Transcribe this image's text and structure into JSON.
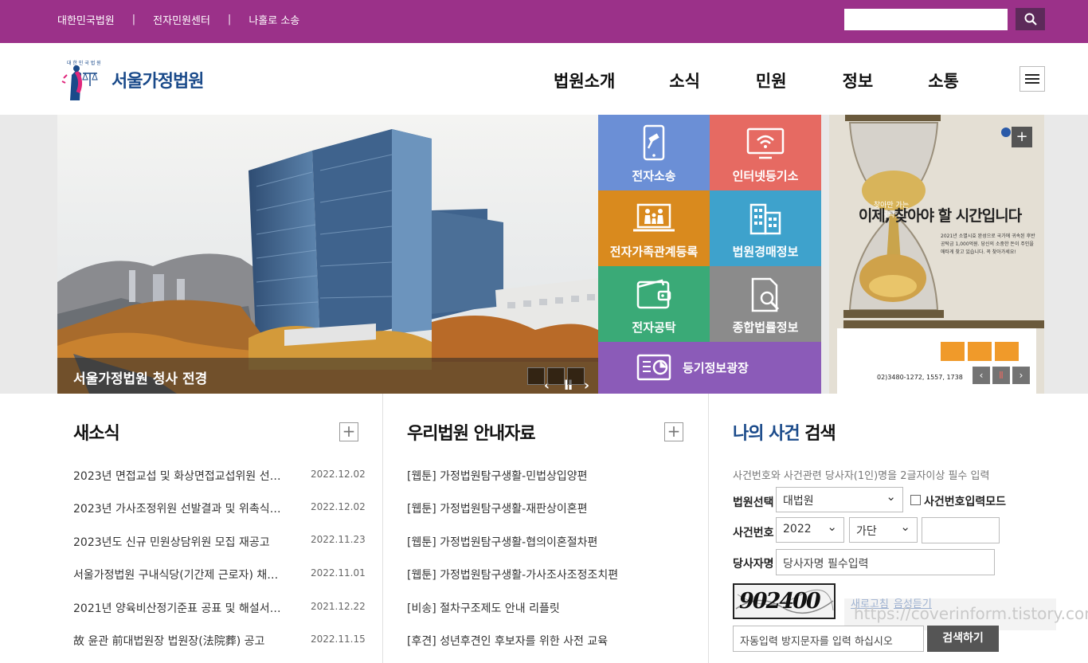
{
  "topbar": {
    "links": [
      "대한민국법원",
      "전자민원센터",
      "나홀로 소송"
    ],
    "separator": "|",
    "search_placeholder": "",
    "search_icon": "search-icon"
  },
  "header": {
    "logo_small_text": "대 한 민 국 법 원",
    "logo_text": "서울가정법원",
    "menu": [
      "법원소개",
      "소식",
      "민원",
      "정보",
      "소통"
    ],
    "menu_icon": "hamburger-icon"
  },
  "visual": {
    "caption": "서울가정법원 청사 전경",
    "prev": "‹",
    "pause": "Ⅱ",
    "next": "›"
  },
  "tiles": [
    {
      "label": "전자소송",
      "icon": "tablet-gavel-icon",
      "color": "#6b8fd6"
    },
    {
      "label": "인터넷등기소",
      "icon": "monitor-wifi-icon",
      "color": "#e66a62"
    },
    {
      "label": "전자가족관계등록",
      "icon": "family-laptop-icon",
      "color": "#d98a1e"
    },
    {
      "label": "법원경매정보",
      "icon": "buildings-icon",
      "color": "#3ea2cc"
    },
    {
      "label": "전자공탁",
      "icon": "wallet-icon",
      "color": "#3aaa77"
    },
    {
      "label": "종합법률정보",
      "icon": "document-search-icon",
      "color": "#8b8b8b"
    },
    {
      "label": "등기정보광장",
      "icon": "chart-board-icon",
      "color": "#8b5bb8"
    }
  ],
  "poster": {
    "top_badge": "찾아만 가는 공탁금",
    "headline": "이제, 찾아야 할 시간입니다",
    "body": "2021년 소멸시효 완성으로 국가에 귀속된 후반 공탁금 1,000억원. 당신의 소중한 돈이 주인을 애타게 찾고 있습니다. 꼭 찾아가세요!",
    "phone": "02)3480-1272, 1557, 1738",
    "plus": "+"
  },
  "news": {
    "title": "새소식",
    "plus": "+",
    "items": [
      {
        "title": "2023년 면접교섭 및 화상면접교섭위원 선…",
        "date": "2022.12.02"
      },
      {
        "title": "2023년 가사조정위원 선발결과 및 위촉식…",
        "date": "2022.12.02"
      },
      {
        "title": "2023년도 신규 민원상담위원 모집 재공고",
        "date": "2022.11.23"
      },
      {
        "title": "서울가정법원 구내식당(기간제 근로자) 채…",
        "date": "2022.11.01"
      },
      {
        "title": "2021년 양육비산정기준표 공표 및 해설서…",
        "date": "2021.12.22"
      },
      {
        "title": "故 윤관 前대법원장 법원장(法院葬) 공고",
        "date": "2022.11.15"
      }
    ]
  },
  "guide": {
    "title": "우리법원 안내자료",
    "plus": "+",
    "items": [
      "[웹툰] 가정법원탐구생활-민법상입양편",
      "[웹툰] 가정법원탐구생활-재판상이혼편",
      "[웹툰] 가정법원탐구생활-협의이혼절차편",
      "[웹툰] 가정법원탐구생활-가사조사조정조치편",
      "[비송] 절차구조제도 안내 리플릿",
      "[후견] 성년후견인 후보자를 위한 사전 교육"
    ]
  },
  "case_search": {
    "title_highlight": "나의 사건",
    "title_rest": " 검색",
    "notice": "사건번호와 사건관련 당사자(1인)명을 2글자이상 필수 입력",
    "court_label": "법원선택",
    "court_value": "대법원",
    "mode_label": "사건번호입력모드",
    "case_label": "사건번호",
    "year_value": "2022",
    "type_value": "가단",
    "case_number_value": "",
    "party_label": "당사자명",
    "party_placeholder": "당사자명 필수입력",
    "captcha_text": "902400",
    "refresh_label": "새로고침",
    "audio_label": "음성듣기",
    "captcha_placeholder": "자동입력 방지문자를 입력 하십시오",
    "search_label": "검색하기"
  },
  "watermark": "https://coverinform.tistory.com",
  "colors": {
    "topbar": "#9b3189",
    "case_title": "#1a4a8a"
  }
}
